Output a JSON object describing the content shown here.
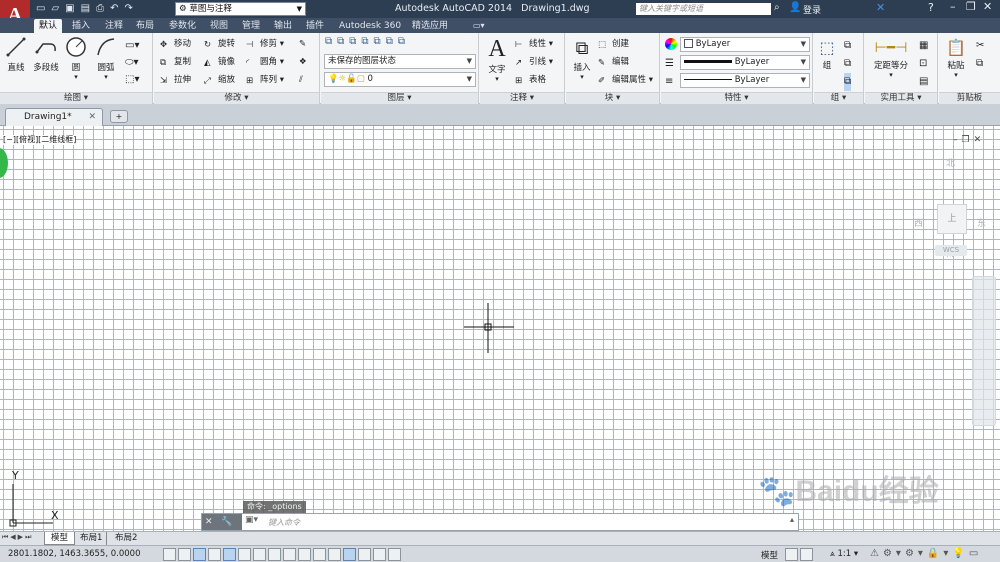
{
  "titlebar": {
    "workspace": "草图与注释",
    "title": "Autodesk AutoCAD 2014",
    "filename": "Drawing1.dwg",
    "search_placeholder": "键入关键字或短语",
    "login": "登录"
  },
  "ribbon_tabs": [
    "默认",
    "插入",
    "注释",
    "布局",
    "参数化",
    "视图",
    "管理",
    "输出",
    "插件",
    "Autodesk 360",
    "精选应用"
  ],
  "active_tab": "默认",
  "draw_panel": {
    "title": "绘图",
    "line": "直线",
    "polyline": "多段线",
    "circle": "圆",
    "arc": "圆弧"
  },
  "modify_panel": {
    "title": "修改",
    "move": "移动",
    "rotate": "旋转",
    "trim": "修剪",
    "copy": "复制",
    "mirror": "镜像",
    "fillet": "圆角",
    "stretch": "拉伸",
    "scale": "缩放",
    "array": "阵列"
  },
  "layer_panel": {
    "title": "图层",
    "state": "未保存的图层状态",
    "layer": "0"
  },
  "annotation_panel": {
    "title": "注释",
    "text": "文字",
    "linear": "线性",
    "leader": "引线",
    "table": "表格"
  },
  "block_panel": {
    "title": "块",
    "insert": "插入",
    "create": "创建",
    "edit": "编辑",
    "edit_attr": "编辑属性"
  },
  "properties_panel": {
    "title": "特性",
    "color": "ByLayer",
    "lineweight": "ByLayer",
    "linetype": "ByLayer"
  },
  "group_panel": {
    "title": "组",
    "group": "组"
  },
  "utilities_panel": {
    "title": "实用工具",
    "measure": "定距等分"
  },
  "clipboard_panel": {
    "title": "剪贴板",
    "paste": "粘贴"
  },
  "document_tab": "Drawing1*",
  "viewport_label": "[−][俯视][二维线框]",
  "viewcube": {
    "north": "北",
    "south": "南",
    "east": "东",
    "west": "西",
    "top": "上",
    "wcs": "WCS"
  },
  "ucs": {
    "x": "X",
    "y": "Y"
  },
  "command": {
    "history": "命令: _options",
    "placeholder": "键入命令"
  },
  "layout_tabs": [
    "模型",
    "布局1",
    "布局2"
  ],
  "status": {
    "coords": "2801.1802, 1463.3655, 0.0000",
    "model": "模型",
    "scale": "1:1"
  },
  "watermark": "Baidu经验"
}
